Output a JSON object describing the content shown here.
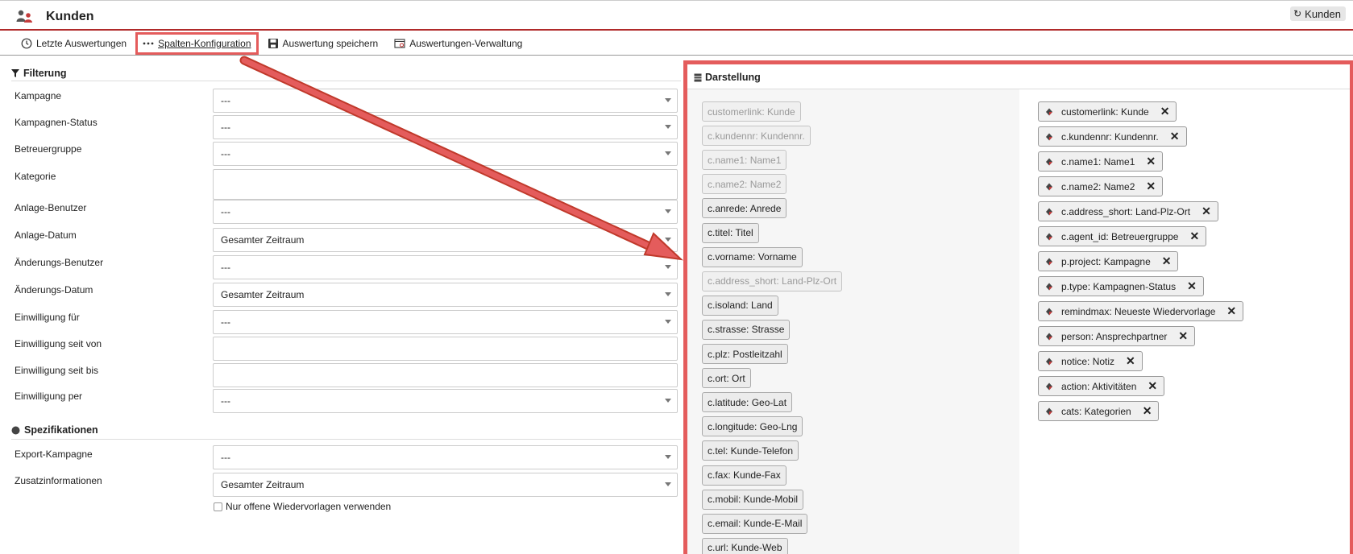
{
  "window": {
    "title": "Kunden",
    "tab_label": "Kunden"
  },
  "toolbar": {
    "recent": "Letzte Auswertungen",
    "columns": "Spalten-Konfiguration",
    "save": "Auswertung speichern",
    "manage": "Auswertungen-Verwaltung"
  },
  "filter": {
    "heading": "Filterung",
    "fields": [
      {
        "label": "Kampagne",
        "value": "---"
      },
      {
        "label": "Kampagnen-Status",
        "value": "---"
      },
      {
        "label": "Betreuergruppe",
        "value": "---"
      },
      {
        "label": "Kategorie",
        "value": ""
      },
      {
        "label": "Anlage-Benutzer",
        "value": "---"
      },
      {
        "label": "Anlage-Datum",
        "value": "Gesamter Zeitraum"
      },
      {
        "label": "Änderungs-Benutzer",
        "value": "---"
      },
      {
        "label": "Änderungs-Datum",
        "value": "Gesamter Zeitraum"
      },
      {
        "label": "Einwilligung für",
        "value": "---"
      },
      {
        "label": "Einwilligung seit von",
        "value": ""
      },
      {
        "label": "Einwilligung seit bis",
        "value": ""
      },
      {
        "label": "Einwilligung per",
        "value": "---"
      }
    ]
  },
  "spec": {
    "heading": "Spezifikationen",
    "fields": [
      {
        "label": "Export-Kampagne",
        "value": "---"
      },
      {
        "label": "Zusatzinformationen",
        "value": "Gesamter Zeitraum"
      }
    ],
    "checkbox_label": "Nur offene Wiedervorlagen verwenden"
  },
  "display": {
    "heading": "Darstellung",
    "available": [
      {
        "label": "customerlink: Kunde",
        "disabled": true
      },
      {
        "label": "c.kundennr: Kundennr.",
        "disabled": true
      },
      {
        "label": "c.name1: Name1",
        "disabled": true
      },
      {
        "label": "c.name2: Name2",
        "disabled": true
      },
      {
        "label": "c.anrede: Anrede",
        "disabled": false
      },
      {
        "label": "c.titel: Titel",
        "disabled": false
      },
      {
        "label": "c.vorname: Vorname",
        "disabled": false
      },
      {
        "label": "c.address_short: Land-Plz-Ort",
        "disabled": true
      },
      {
        "label": "c.isoland: Land",
        "disabled": false
      },
      {
        "label": "c.strasse: Strasse",
        "disabled": false
      },
      {
        "label": "c.plz: Postleitzahl",
        "disabled": false
      },
      {
        "label": "c.ort: Ort",
        "disabled": false
      },
      {
        "label": "c.latitude: Geo-Lat",
        "disabled": false
      },
      {
        "label": "c.longitude: Geo-Lng",
        "disabled": false
      },
      {
        "label": "c.tel: Kunde-Telefon",
        "disabled": false
      },
      {
        "label": "c.fax: Kunde-Fax",
        "disabled": false
      },
      {
        "label": "c.mobil: Kunde-Mobil",
        "disabled": false
      },
      {
        "label": "c.email: Kunde-E-Mail",
        "disabled": false
      },
      {
        "label": "c.url: Kunde-Web",
        "disabled": false
      }
    ],
    "selected": [
      "customerlink: Kunde",
      "c.kundennr: Kundennr.",
      "c.name1: Name1",
      "c.name2: Name2",
      "c.address_short: Land-Plz-Ort",
      "c.agent_id: Betreuergruppe",
      "p.project: Kampagne",
      "p.type: Kampagnen-Status",
      "remindmax: Neueste Wiedervorlage",
      "person: Ansprechpartner",
      "notice: Notiz",
      "action: Aktivitäten",
      "cats: Kategorien"
    ]
  },
  "colors": {
    "accent_red": "#e45c5c",
    "titlebar_rule": "#b02a2a"
  }
}
